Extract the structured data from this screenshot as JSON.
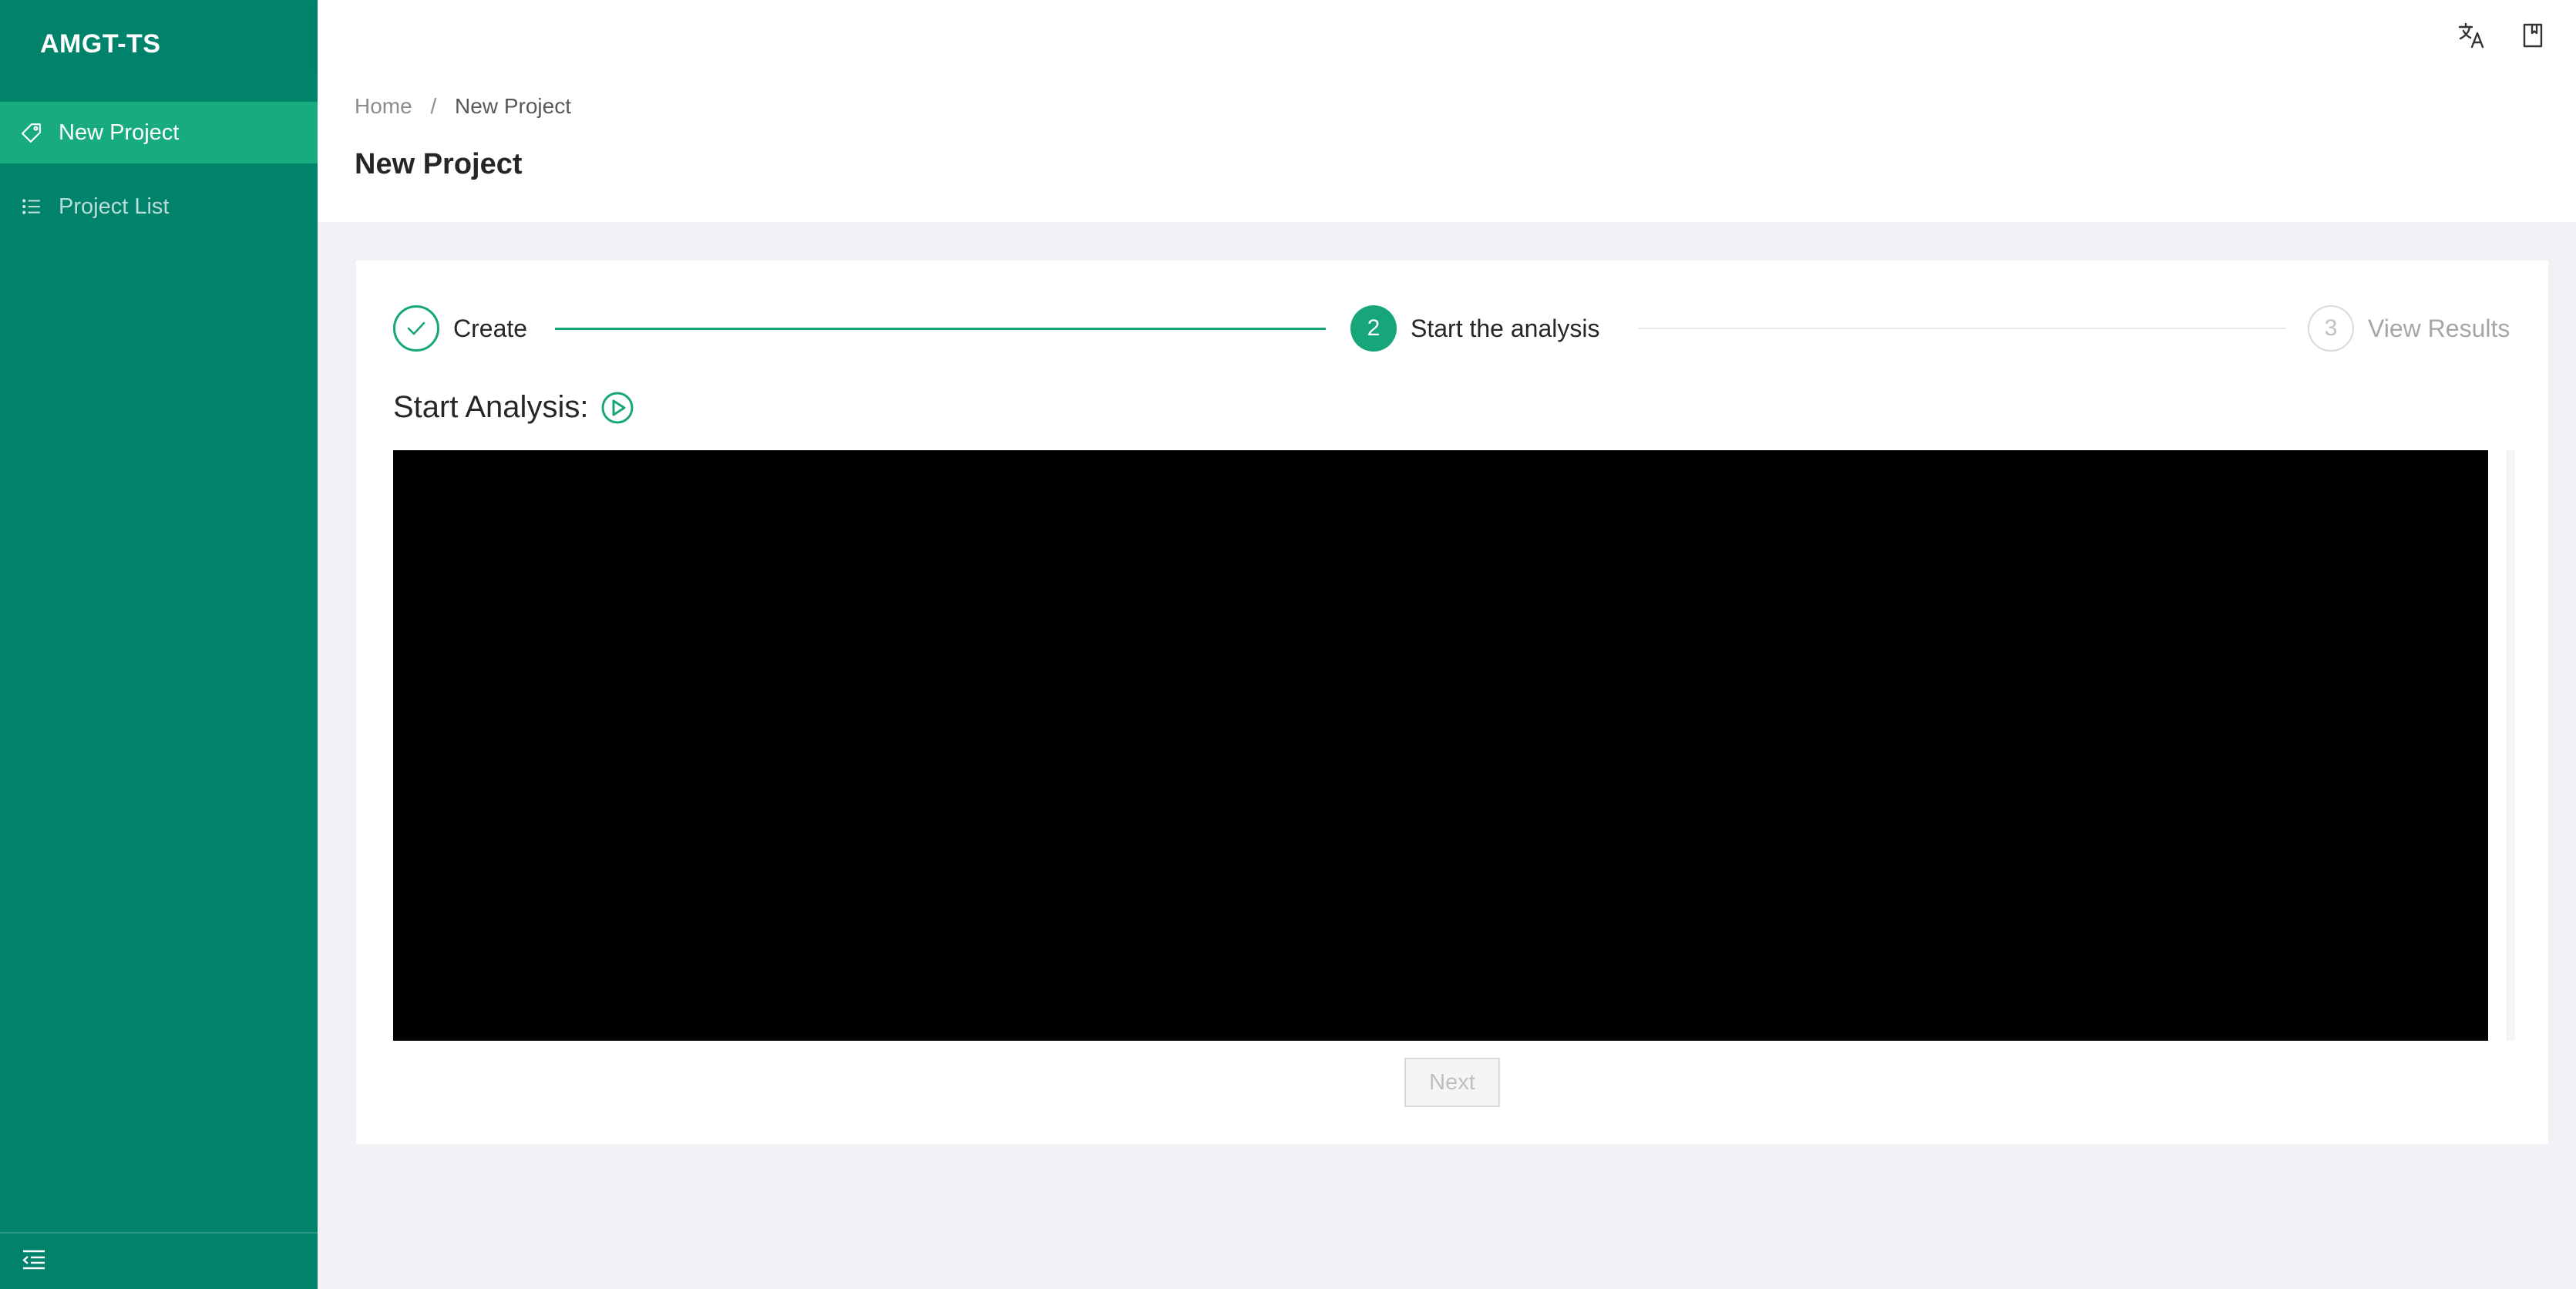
{
  "app": {
    "name": "AMGT-TS"
  },
  "sidebar": {
    "items": [
      {
        "label": "New Project",
        "icon": "tag-icon",
        "active": true
      },
      {
        "label": "Project List",
        "icon": "list-icon",
        "active": false
      }
    ],
    "footer_icon": "menu-fold-icon"
  },
  "header": {
    "icons": [
      "translate-icon",
      "book-icon"
    ]
  },
  "breadcrumb": {
    "home": "Home",
    "separator": "/",
    "current": "New Project"
  },
  "page": {
    "title": "New Project"
  },
  "steps": [
    {
      "number": "1",
      "title": "Create",
      "status": "finished"
    },
    {
      "number": "2",
      "title": "Start the analysis",
      "status": "process"
    },
    {
      "number": "3",
      "title": "View Results",
      "status": "wait"
    }
  ],
  "analysis": {
    "title": "Start Analysis:",
    "play_icon": "play-circle-icon"
  },
  "actions": {
    "next_label": "Next",
    "next_disabled": true
  },
  "colors": {
    "sidebar": "#00826b",
    "active_item": "#17ab7d",
    "accent": "#17a67a",
    "background": "#f0f2f5"
  }
}
